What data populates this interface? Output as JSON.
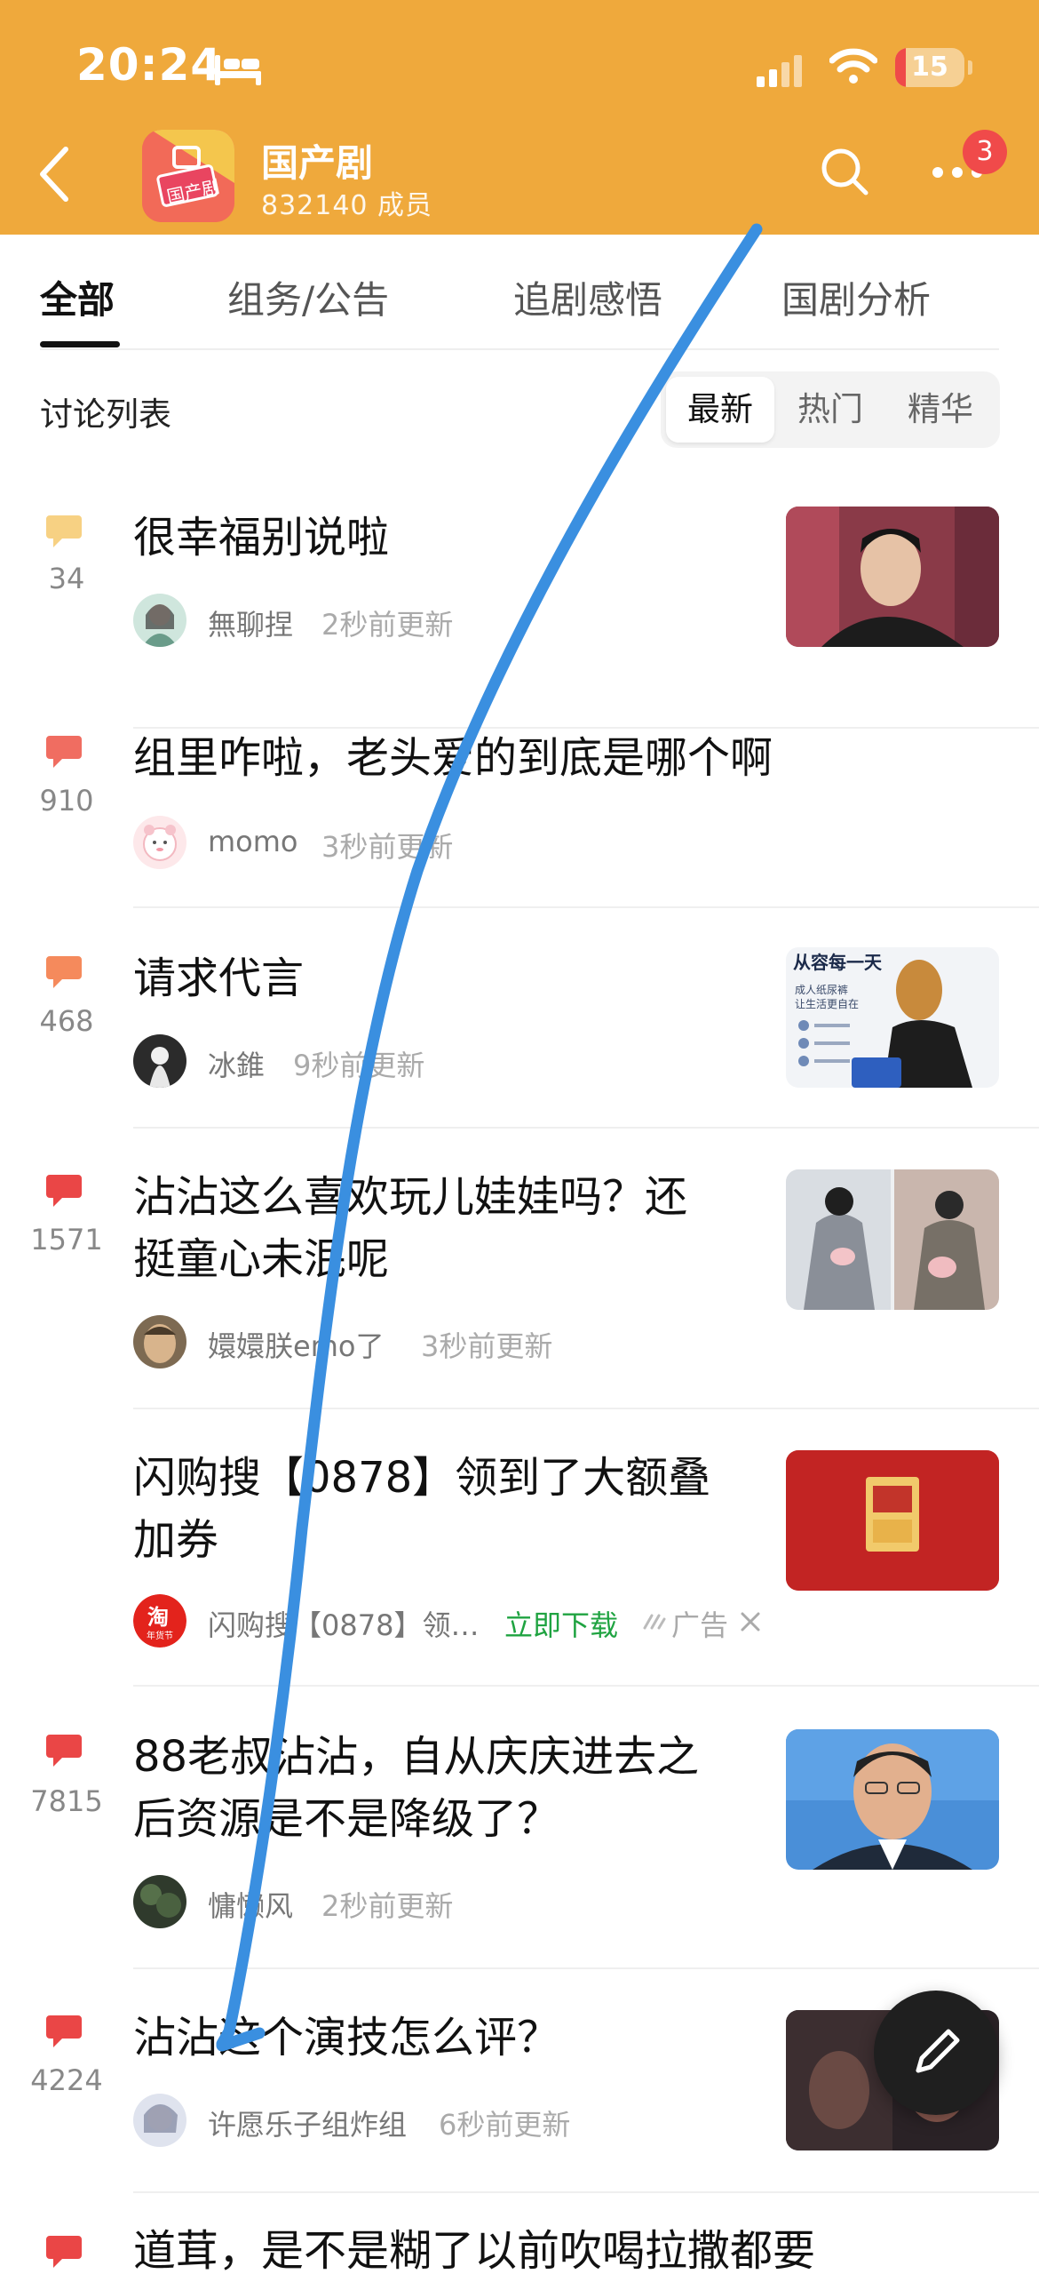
{
  "status_bar": {
    "time": "20:24",
    "battery": "15",
    "battery_level": 0.15
  },
  "header": {
    "avatar_text": "国产剧",
    "title": "国产剧",
    "members": "832140 成员",
    "notification_count": "3"
  },
  "tabs": [
    "全部",
    "组务/公告",
    "追剧感悟",
    "国剧分析"
  ],
  "list": {
    "title": "讨论列表",
    "sort_options": [
      "最新",
      "热门",
      "精华"
    ],
    "selected_sort": "最新"
  },
  "posts": [
    {
      "count": "34",
      "title_lines": [
        "很幸福别说啦"
      ],
      "user": "無聊捏",
      "time": "2秒前更新",
      "icon_color": "#f7d183"
    },
    {
      "count": "910",
      "title_lines": [
        "组里咋啦，老头爱的到底是哪个啊"
      ],
      "user": "momo",
      "time": "3秒前更新",
      "icon_color": "#f06d61"
    },
    {
      "count": "468",
      "title_lines": [
        "请求代言"
      ],
      "user": "冰錐",
      "time": "9秒前更新",
      "icon_color": "#f58a5c",
      "thumb_text": [
        "从容每一天",
        "成人纸尿裤",
        "让生活更自在"
      ]
    },
    {
      "count": "1571",
      "title_lines": [
        "沾沾这么喜欢玩儿娃娃吗？还",
        "挺童心未泯呢"
      ],
      "user": "嬛嬛朕emo了",
      "time": "3秒前更新",
      "icon_color": "#ea4646"
    },
    {
      "ad": true,
      "title_lines": [
        "闪购搜【0878】领到了大额叠",
        "加券"
      ],
      "user": "闪购搜【0878】领…",
      "download": "立即下载",
      "ad_label": "广告",
      "avatar_text": [
        "淘",
        "年货节"
      ]
    },
    {
      "count": "7815",
      "title_lines": [
        "88老叔沾沾，自从庆庆进去之",
        "后资源是不是降级了？"
      ],
      "user": "慵懒风",
      "time": "2秒前更新",
      "icon_color": "#ea4646"
    },
    {
      "count": "4224",
      "title_lines": [
        "沾沾这个演技怎么评？"
      ],
      "user": "许愿乐子组炸组",
      "time": "6秒前更新",
      "icon_color": "#ea4646"
    },
    {
      "title_lines": [
        "道茸，是不是糊了以前吹喝拉撒都要"
      ],
      "icon_color": "#ea4646"
    }
  ]
}
